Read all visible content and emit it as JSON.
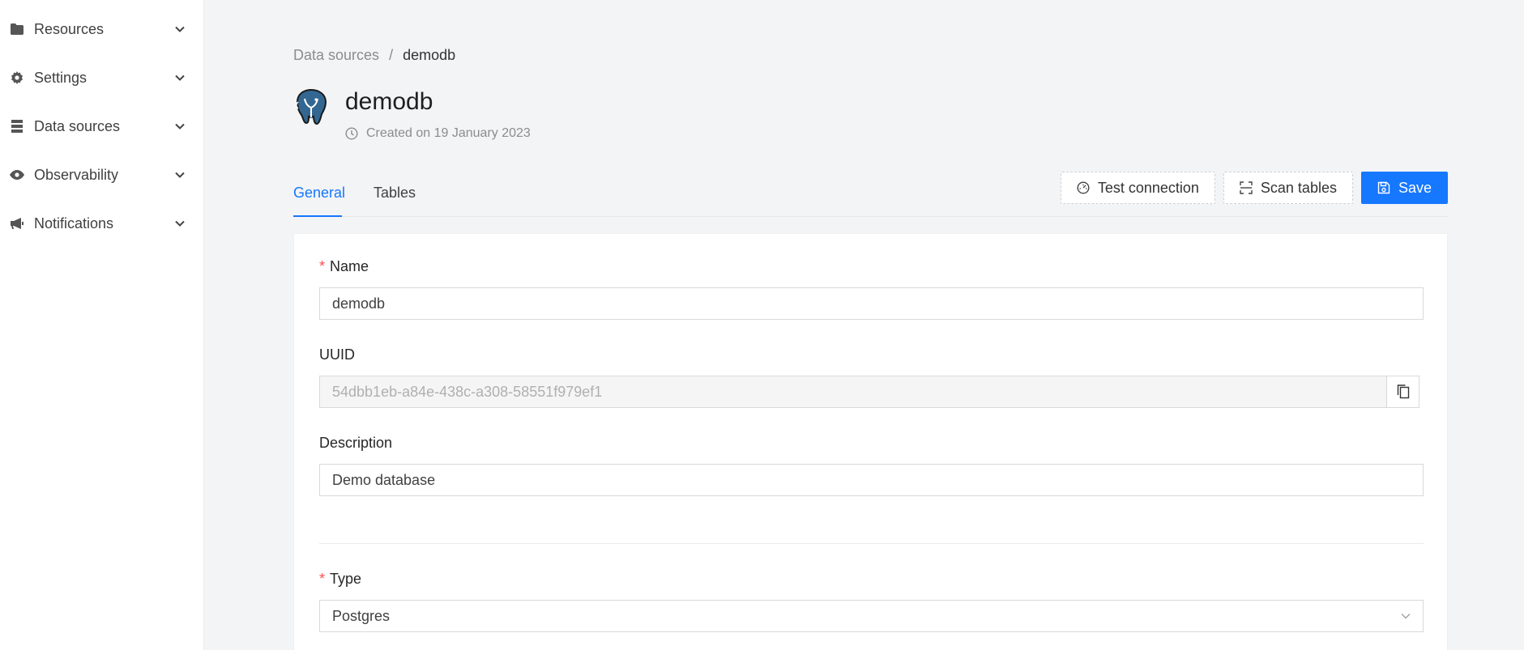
{
  "sidebar": {
    "items": [
      {
        "label": "Resources",
        "icon": "folder-icon"
      },
      {
        "label": "Settings",
        "icon": "gear-icon"
      },
      {
        "label": "Data sources",
        "icon": "database-icon"
      },
      {
        "label": "Observability",
        "icon": "eye-icon"
      },
      {
        "label": "Notifications",
        "icon": "megaphone-icon"
      }
    ]
  },
  "breadcrumb": {
    "parent": "Data sources",
    "separator": "/",
    "current": "demodb"
  },
  "header": {
    "title": "demodb",
    "created": "Created on 19 January 2023",
    "logo_icon": "postgres-elephant-icon"
  },
  "tabs": [
    {
      "label": "General",
      "active": true
    },
    {
      "label": "Tables",
      "active": false
    }
  ],
  "actions": {
    "test_connection": "Test connection",
    "scan_tables": "Scan tables",
    "save": "Save"
  },
  "form": {
    "name_label": "Name",
    "name_value": "demodb",
    "uuid_label": "UUID",
    "uuid_value": "54dbb1eb-a84e-438c-a308-58551f979ef1",
    "description_label": "Description",
    "description_value": "Demo database",
    "type_label": "Type",
    "type_value": "Postgres"
  },
  "colors": {
    "accent": "#1677ff",
    "required": "#ff4d4f"
  }
}
